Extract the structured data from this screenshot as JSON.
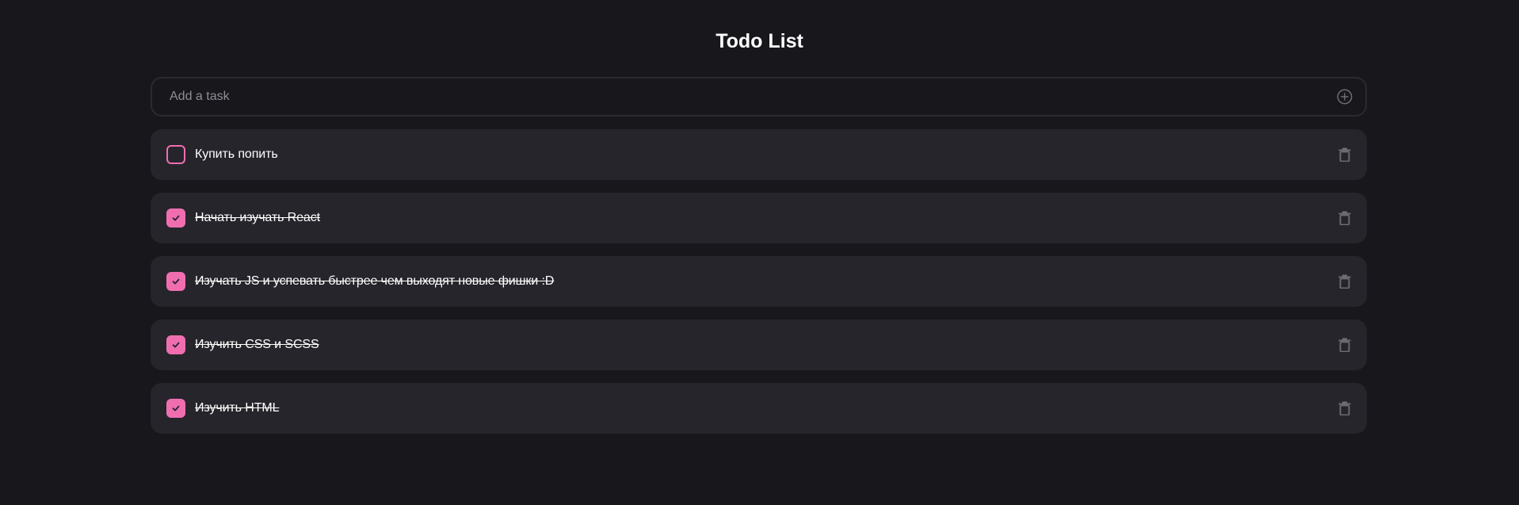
{
  "app": {
    "title": "Todo List"
  },
  "add_task": {
    "placeholder": "Add a task",
    "value": "",
    "button_icon": "plus-circle-icon"
  },
  "tasks": [
    {
      "text": "Купить попить",
      "done": false
    },
    {
      "text": "Начать изучать React",
      "done": true
    },
    {
      "text": "Изучать JS и успевать быстрее чем выходят новые фишки :D",
      "done": true
    },
    {
      "text": "Изучить CSS и SCSS",
      "done": true
    },
    {
      "text": "Изучить HTML",
      "done": true
    }
  ],
  "colors": {
    "background": "#18171c",
    "card": "#26252b",
    "accent": "#f06eb0",
    "muted_icon": "#6f6e76",
    "border": "#2b2a31"
  }
}
